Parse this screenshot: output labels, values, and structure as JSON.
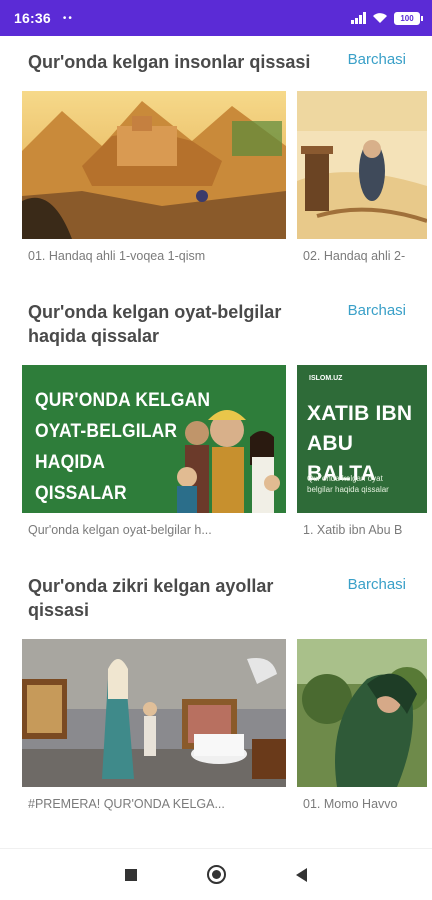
{
  "status_bar": {
    "time": "16:36",
    "dots": "••",
    "battery": "100"
  },
  "sections": [
    {
      "title": "Qur'onda kelgan insonlar qissasi",
      "see_all": "Barchasi",
      "cards": [
        {
          "caption": "01. Handaq ahli 1-voqea 1-qism"
        },
        {
          "caption": "02. Handaq ahli 2-"
        }
      ]
    },
    {
      "title": "Qur'onda kelgan oyat-belgilar haqida qissalar",
      "see_all": "Barchasi",
      "cards": [
        {
          "caption": "Qur'onda kelgan oyat-belgilar h...",
          "thumb_text": "QUR'ONDA KELGAN\nOYAT-BELGILAR\nHAQIDA\nQISSALAR"
        },
        {
          "caption": "1. Xatib ibn Abu B",
          "thumb_brand": "ISLOM.UZ",
          "thumb_title": "XATIB IBN\nABU BALTA",
          "thumb_sub": "Qur'onda kelgan oyat\nbelgilar haqida qissalar"
        }
      ]
    },
    {
      "title": "Qur'onda zikri kelgan ayollar qissasi",
      "see_all": "Barchasi",
      "cards": [
        {
          "caption": "#PREMERA! QUR'ONDA KELGA..."
        },
        {
          "caption": "01. Momo Havvo"
        }
      ]
    }
  ],
  "colors": {
    "status_bar": "#5b2bd6",
    "link": "#3aa0c8",
    "green_thumb": "#2e7d3a"
  }
}
